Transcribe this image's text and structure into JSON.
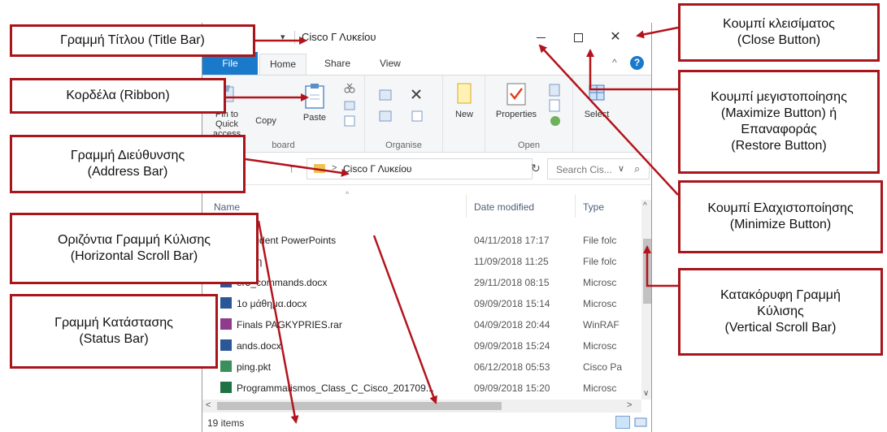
{
  "window": {
    "title": "Cisco Γ Λυκείου",
    "qat_arrow": "▾",
    "min_glyph": "",
    "close_glyph": "✕"
  },
  "tabs": {
    "file": "File",
    "home": "Home",
    "share": "Share",
    "view": "View",
    "collapse_glyph": "^",
    "help_glyph": "?"
  },
  "ribbon": {
    "pin_label_1": "Pin to Quick",
    "pin_label_2": "access",
    "copy": "Copy",
    "paste": "Paste",
    "clipboard_label": "board",
    "organise_label": "Organise",
    "new": "New",
    "properties": "Properties",
    "open_label": "Open",
    "select": "Select"
  },
  "address": {
    "path": "Cisco Γ Λυκείου",
    "search_placeholder": "Search Cis...",
    "up_glyph": "↑",
    "chev_glyph": ">",
    "dd_glyph": "∨",
    "refresh_glyph": "↻",
    "search_glyph": "⌕"
  },
  "columns": {
    "name": "Name",
    "date": "Date modified",
    "type": "Type",
    "sort_glyph": "^"
  },
  "files": [
    {
      "name": "5 Student PowerPoints",
      "date": "04/11/2018 17:17",
      "type": "File folc",
      "icon": "folder-icon"
    },
    {
      "name": "λη ψη",
      "date": "11/09/2018 11:25",
      "type": "File folc",
      "icon": "folder-icon"
    },
    {
      "name": "er5_commands.docx",
      "date": "29/11/2018 08:15",
      "type": "Microsc",
      "icon": "word-doc-icon"
    },
    {
      "name": "1ο μάθημα.docx",
      "date": "09/09/2018 15:14",
      "type": "Microsc",
      "icon": "word-doc-icon"
    },
    {
      "name": "Finals PAGKYPRIES.rar",
      "date": "04/09/2018 20:44",
      "type": "WinRAF",
      "icon": "rar-archive-icon"
    },
    {
      "name": "ands.docx",
      "date": "09/09/2018 15:24",
      "type": "Microsc",
      "icon": "word-doc-icon"
    },
    {
      "name": "ping.pkt",
      "date": "06/12/2018 05:53",
      "type": "Cisco Pa",
      "icon": "packet-tracer-icon"
    },
    {
      "name": "Programmatismos_Class_C_Cisco_201709...",
      "date": "09/09/2018 15:20",
      "type": "Microsc",
      "icon": "excel-icon"
    }
  ],
  "scroll": {
    "up": "^",
    "down": "∨",
    "left": "<",
    "right": ">"
  },
  "status": {
    "items": "19 items"
  },
  "annotations": {
    "title_bar": "Γραμμή Τίτλου (Title Bar)",
    "ribbon": "Κορδέλα (Ribbon)",
    "address_1": "Γραμμή Διεύθυνσης",
    "address_2": "(Address Bar)",
    "hscroll_1": "Οριζόντια Γραμμή Κύλισης",
    "hscroll_2": "(Horizontal Scroll Bar)",
    "status_1": "Γραμμή Κατάστασης",
    "status_2": "(Status Bar)",
    "close_1": "Κουμπί κλεισίματος",
    "close_2": "(Close Button)",
    "max_1": "Κουμπί μεγιστοποίησης",
    "max_2": "(Maximize Button) ή",
    "max_3": "Επαναφοράς",
    "max_4": "(Restore Button)",
    "min_1": "Κουμπί Ελαχιστοποίησης",
    "min_2": "(Minimize Button)",
    "vscroll_1": "Κατακόρυφη Γραμμή",
    "vscroll_2": "Κύλισης",
    "vscroll_3": "(Vertical Scroll Bar)"
  },
  "colors": {
    "callout_border": "#a8151b",
    "arrow": "#b3141c",
    "file_tab": "#1979ca",
    "folder": "#f0c24f"
  }
}
